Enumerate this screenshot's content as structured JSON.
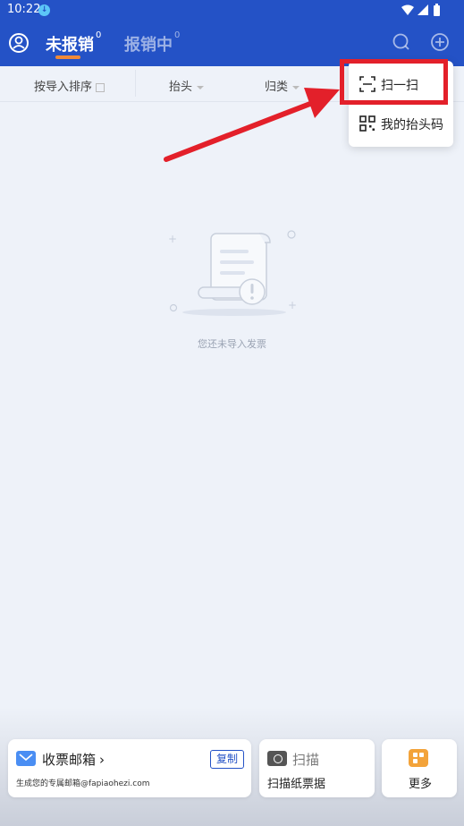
{
  "status_bar": {
    "time": "10:22"
  },
  "header": {
    "tabs": [
      {
        "label": "未报销",
        "count": "0"
      },
      {
        "label": "报销中",
        "count": "0"
      }
    ]
  },
  "filters": [
    {
      "label": "按导入排序"
    },
    {
      "label": "抬头"
    },
    {
      "label": "归类"
    }
  ],
  "dropdown": {
    "items": [
      {
        "label": "扫一扫"
      },
      {
        "label": "我的抬头码"
      }
    ]
  },
  "empty_state": {
    "text": "您还未导入发票"
  },
  "bottom_cards": {
    "email": {
      "title": "收票邮箱",
      "copy_label": "复制",
      "subtitle": "生成您的专属邮箱@fapiaohezi.com"
    },
    "scan": {
      "title": "扫描",
      "subtitle": "扫描纸票据"
    },
    "more": {
      "label": "更多"
    }
  },
  "colors": {
    "header": "#2452c6",
    "accent": "#f08a38",
    "highlight": "#e3202a",
    "background": "#eef2f9"
  }
}
